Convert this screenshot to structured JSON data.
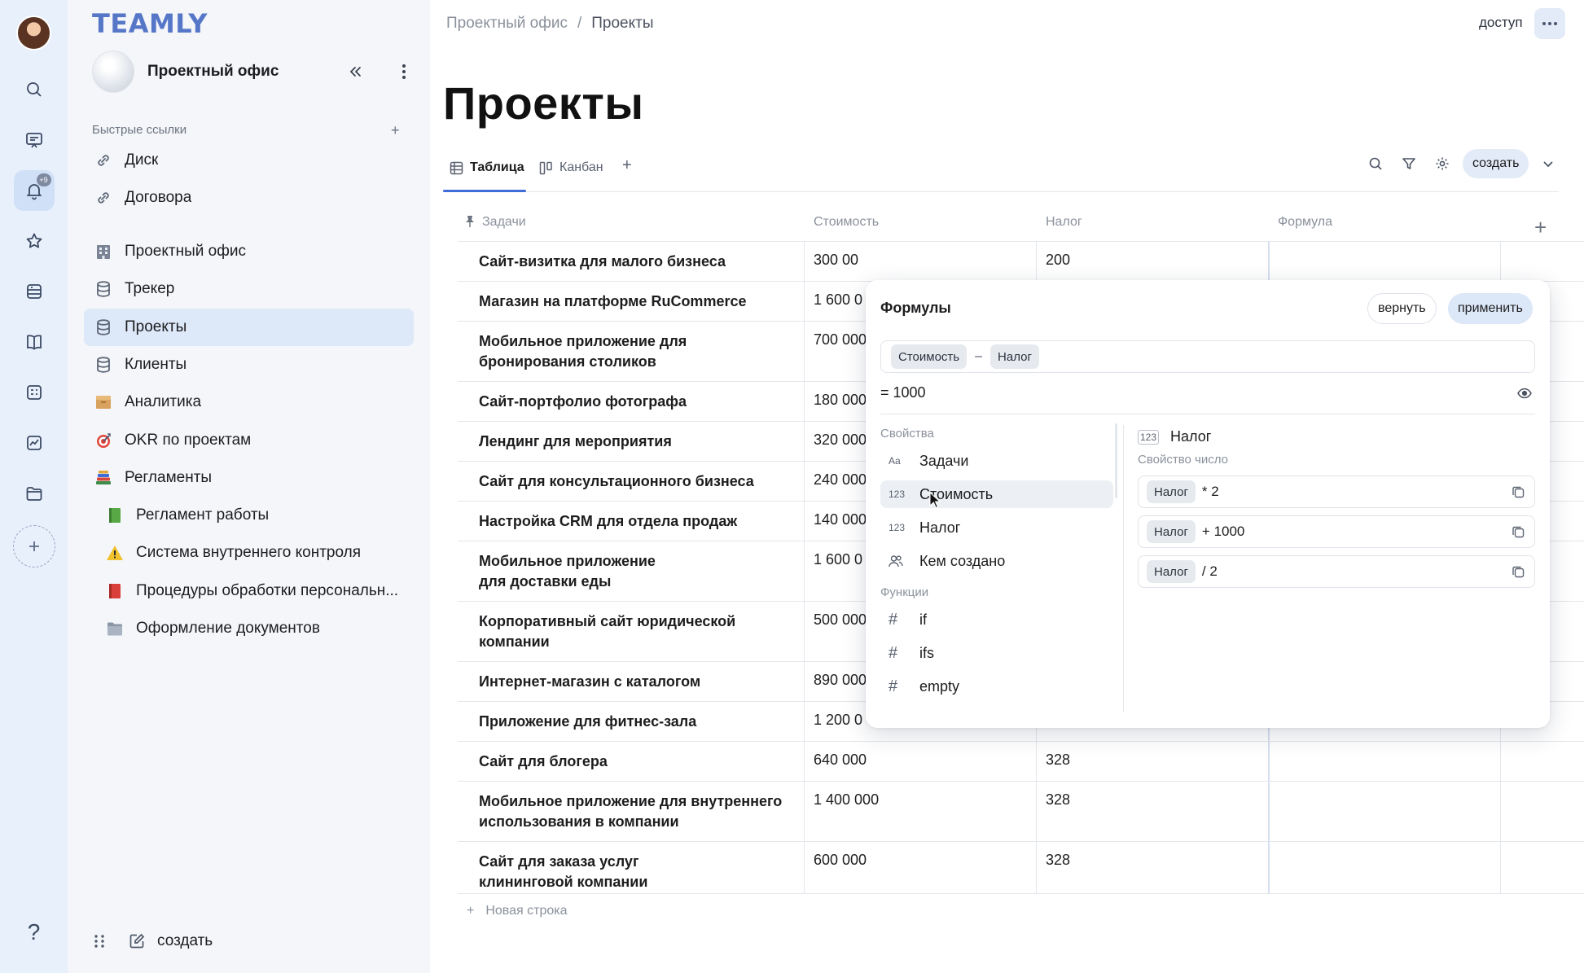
{
  "app": {
    "logo": "TEAMLY"
  },
  "rail": {
    "badge": "+9",
    "help": "?"
  },
  "sidebar": {
    "workspace": "Проектный офис",
    "quick_links_title": "Быстрые ссылки",
    "quick_links": [
      {
        "label": "Диск",
        "icon": "link-icon"
      },
      {
        "label": "Договора",
        "icon": "link-icon"
      }
    ],
    "items": [
      {
        "label": "Проектный офис",
        "icon": "building-icon"
      },
      {
        "label": "Трекер",
        "icon": "database-icon"
      },
      {
        "label": "Проекты",
        "icon": "database-icon"
      },
      {
        "label": "Клиенты",
        "icon": "database-icon"
      },
      {
        "label": "Аналитика",
        "icon": "box-icon"
      },
      {
        "label": "OKR по проектам",
        "icon": "target-icon"
      },
      {
        "label": "Регламенты",
        "icon": "books-icon"
      },
      {
        "label": "Регламент работы",
        "icon": "green-book-icon"
      },
      {
        "label": "Система внутреннего контроля",
        "icon": "warning-icon"
      },
      {
        "label": "Процедуры обработки персональн...",
        "icon": "red-book-icon"
      },
      {
        "label": "Оформление документов",
        "icon": "folder-icon"
      }
    ],
    "bottom_create": "создать"
  },
  "header": {
    "breadcrumb_root": "Проектный офис",
    "breadcrumb_sep": "/",
    "breadcrumb_current": "Проекты",
    "access": "доступ"
  },
  "page": {
    "title": "Проекты",
    "tabs": [
      {
        "label": "Таблица"
      },
      {
        "label": "Канбан"
      }
    ],
    "create": "создать"
  },
  "table": {
    "columns": [
      "Задачи",
      "Стоимость",
      "Налог",
      "Формула"
    ],
    "rows": [
      {
        "task": "Сайт-визитка для малого бизнеса",
        "cost": "300 00",
        "tax": "200"
      },
      {
        "task": "Магазин на платформе RuCommerce",
        "cost": "1 600 0",
        "tax": ""
      },
      {
        "task": "Мобильное приложение для бронирования столиков",
        "cost": "700 000",
        "tax": ""
      },
      {
        "task": "Сайт-портфолио фотографа",
        "cost": "180 000",
        "tax": ""
      },
      {
        "task": "Лендинг для мероприятия",
        "cost": "320 000",
        "tax": ""
      },
      {
        "task": "Сайт для консультационного бизнеса",
        "cost": "240 000",
        "tax": ""
      },
      {
        "task": "Настройка CRM для отдела продаж",
        "cost": "140 000",
        "tax": ""
      },
      {
        "task": "Мобильное приложение для доставки еды",
        "cost": "1 600 0",
        "tax": ""
      },
      {
        "task": "Корпоративный сайт юридической компании",
        "cost": "500 000",
        "tax": ""
      },
      {
        "task": "Интернет-магазин с каталогом",
        "cost": "890 000",
        "tax": ""
      },
      {
        "task": "Приложение для фитнес-зала",
        "cost": "1 200 0",
        "tax": ""
      },
      {
        "task": "Сайт для блогера",
        "cost": "640 000",
        "tax": "328"
      },
      {
        "task": "Мобильное приложение для внутреннего использования в компании",
        "cost": "1 400 000",
        "tax": "328"
      },
      {
        "task": "Сайт для заказа услуг клининговой компании",
        "cost": "600 000",
        "tax": "328"
      }
    ],
    "new_row": "Новая строка"
  },
  "formula": {
    "title": "Формулы",
    "revert": "вернуть",
    "apply": "применить",
    "chip_a": "Стоимость",
    "operator": "–",
    "chip_b": "Налог",
    "result": "= 1000",
    "properties_title": "Свойства",
    "properties": [
      {
        "label": "Задачи",
        "icon": "text-type-icon",
        "glyph": "Aa"
      },
      {
        "label": "Стоимость",
        "icon": "number-type-icon",
        "glyph": "123"
      },
      {
        "label": "Налог",
        "icon": "number-type-icon",
        "glyph": "123"
      },
      {
        "label": "Кем создано",
        "icon": "users-icon",
        "glyph": ""
      }
    ],
    "functions_title": "Функции",
    "functions": [
      {
        "label": "if",
        "glyph": "#"
      },
      {
        "label": "ifs",
        "glyph": "#"
      },
      {
        "label": "empty",
        "glyph": "#"
      }
    ],
    "detail_glyph": "123",
    "detail_title": "Налог",
    "detail_subtitle": "Свойство число",
    "examples": [
      {
        "chip": "Налог",
        "expr": "* 2"
      },
      {
        "chip": "Налог",
        "expr": "+ 1000"
      },
      {
        "chip": "Налог",
        "expr": "/ 2"
      }
    ]
  }
}
